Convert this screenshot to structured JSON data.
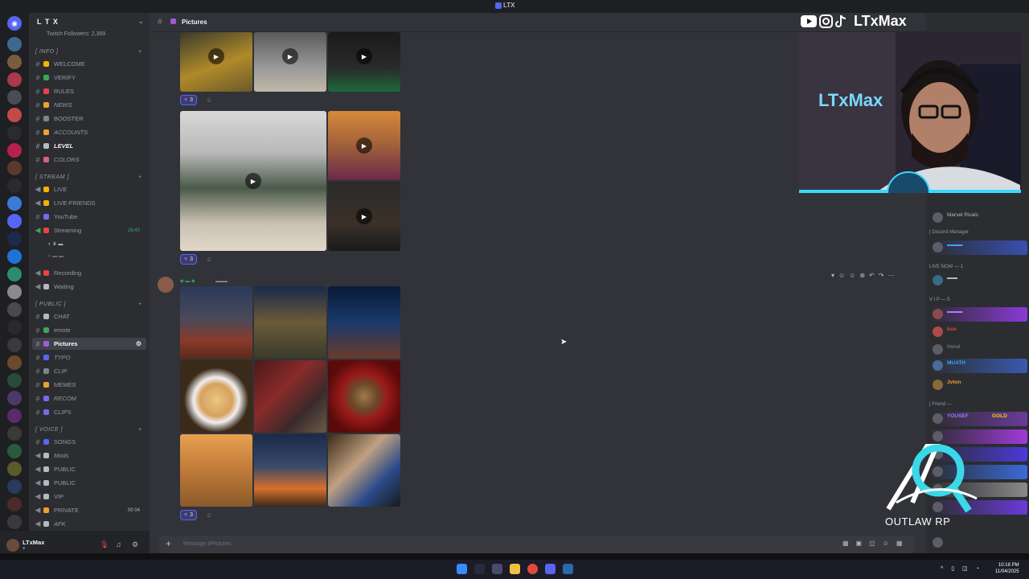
{
  "window": {
    "title": "LTX"
  },
  "server": {
    "name": "L T X",
    "followers": "Twitch Followers: 2,369"
  },
  "categories": {
    "info": "[ INFO ]",
    "stream": "[ STREAM ]",
    "public": "[ PUBLIC ]",
    "voice": "[ VOICE ]"
  },
  "channels": {
    "welcome": "WELCOME",
    "verify": "VERIFY",
    "rules": "RULES",
    "news": "NEWS",
    "booster": "BOOSTER",
    "accounts": "ACCOUNTS",
    "level": "LEVEL",
    "colors": "COLORS",
    "live": "LIVE",
    "live_friends": "LIVE-FRIENDS",
    "youtube": "YouTube",
    "streaming": "Streaming",
    "streaming_badge": "26:40",
    "recording": "Recording",
    "waiting": "Waiting",
    "chat": "CHAT",
    "emote": "emote",
    "pictures": "Pictures",
    "typo": "TYPO",
    "clip": "CLIP",
    "memes": "MEMES",
    "recom": "RECOM",
    "clips": "CLIPS",
    "songs": "SONGS",
    "mods": "Mods",
    "public1": "PUBLIC",
    "public2": "PUBLIC",
    "vip": "VIP",
    "private": "PRIVATE",
    "private_badge": "00 04",
    "afk": "AFK"
  },
  "user": {
    "name": "LTxMax"
  },
  "header": {
    "channel": "Pictures"
  },
  "messages": {
    "react1": "3",
    "react2": "3",
    "react3": "3"
  },
  "composer": {
    "placeholder": "Message #Pictures"
  },
  "members": {
    "discord_manager": "| Discord Manager",
    "live_now": "LIVE NOW — 1",
    "vip": "V I P — 5",
    "friend": "| Friend —",
    "names": [
      "Marvel Rivals",
      "bsn",
      "Hend",
      "MUATH",
      "Jvton",
      "YOUSEF",
      "GOLD"
    ]
  },
  "overlay": {
    "handle": "LTxMax",
    "neon": "LTxMax",
    "rp": "OUTLAW RP"
  },
  "taskbar": {
    "time": "10:18 PM",
    "date": "11/04/2025"
  }
}
